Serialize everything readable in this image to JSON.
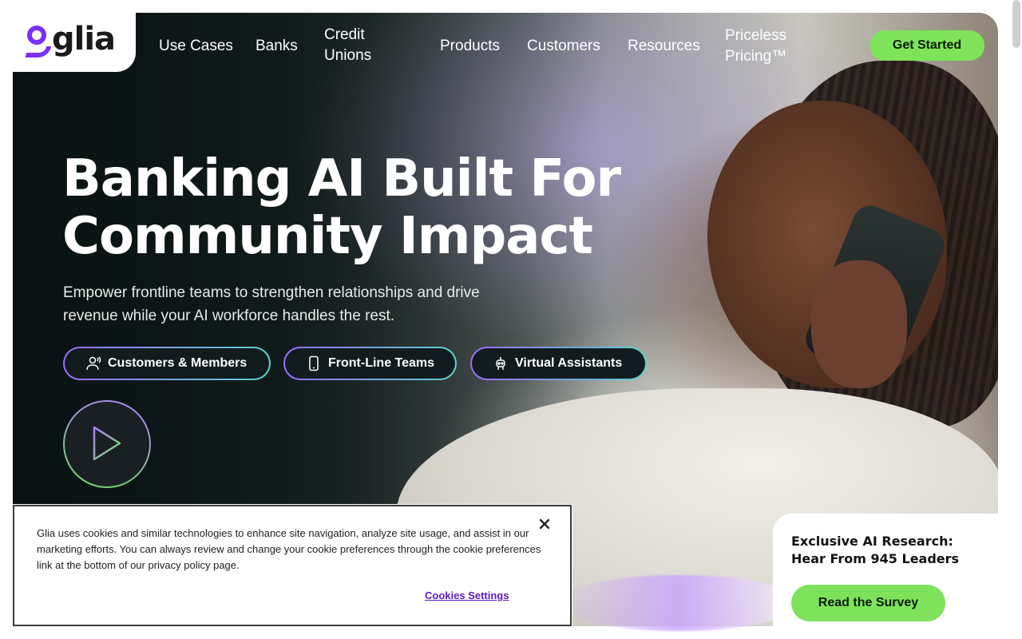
{
  "brand": {
    "logo_text": "glia",
    "accent": "#7b2ff7",
    "cta_color": "#7ee35a"
  },
  "nav": {
    "items": [
      {
        "label": "Use Cases"
      },
      {
        "label": "Banks"
      },
      {
        "label_line1": "Credit",
        "label_line2": "Unions"
      },
      {
        "label": "Products"
      },
      {
        "label": "Customers"
      },
      {
        "label": "Resources"
      },
      {
        "label_line1": "Priceless",
        "label_line2": "Pricing™"
      }
    ],
    "cta": "Get Started"
  },
  "hero": {
    "headline_line1": "Banking AI Built For",
    "headline_line2": "Community Impact",
    "subhead": "Empower frontline teams to strengthen relationships and drive revenue while your AI workforce handles the rest.",
    "pills": [
      {
        "label": "Customers & Members",
        "icon": "people-icon"
      },
      {
        "label": "Front-Line Teams",
        "icon": "phone-icon"
      },
      {
        "label": "Virtual Assistants",
        "icon": "robot-icon"
      }
    ],
    "play_icon": "play-icon"
  },
  "cookie_banner": {
    "text": "Glia uses cookies and similar technologies to enhance site navigation, analyze site usage, and assist in our marketing efforts. You can always review and change your cookie preferences through the cookie preferences link at the bottom of our privacy policy page.",
    "settings_label": "Cookies Settings",
    "close_icon": "close-icon"
  },
  "promo": {
    "title_line1": "Exclusive AI Research:",
    "title_line2": "Hear From 945 Leaders",
    "button": "Read the Survey"
  }
}
